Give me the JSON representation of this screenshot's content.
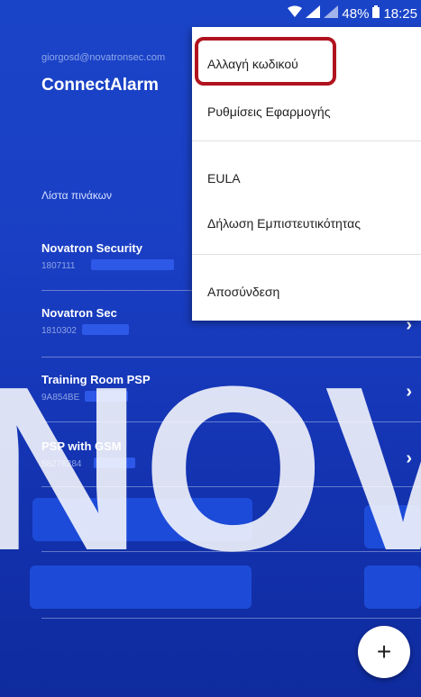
{
  "status_bar": {
    "battery_percent": "48%",
    "time": "18:25",
    "icons": [
      "wifi-icon",
      "signal-icon",
      "signal-icon",
      "battery-icon"
    ]
  },
  "drawer": {
    "email": "giorgosd@novatronsec.com",
    "app_title": "ConnectAlarm",
    "section_label": "Λίστα πινάκων"
  },
  "panels": [
    {
      "name": "Novatron Security",
      "id": "1807111"
    },
    {
      "name": "Novatron Sec",
      "id": "1810302"
    },
    {
      "name": "Training Room PSP",
      "id": "9A854BE"
    },
    {
      "name": "PSP with GSM",
      "id": "58278284"
    }
  ],
  "menu": {
    "items": [
      {
        "label": "Αλλαγή κωδικού"
      },
      {
        "label": "Ρυθμίσεις Εφαρμογής"
      },
      {
        "label": "EULA"
      },
      {
        "label": "Δήλωση Εμπιστευτικότητας"
      },
      {
        "label": "Αποσύνδεση"
      }
    ]
  },
  "fab": {
    "label": "+"
  },
  "watermark": {
    "text": "NOVATRON SECURITY"
  },
  "colors": {
    "accent": "#1a44c8",
    "highlight": "#b0131e"
  }
}
